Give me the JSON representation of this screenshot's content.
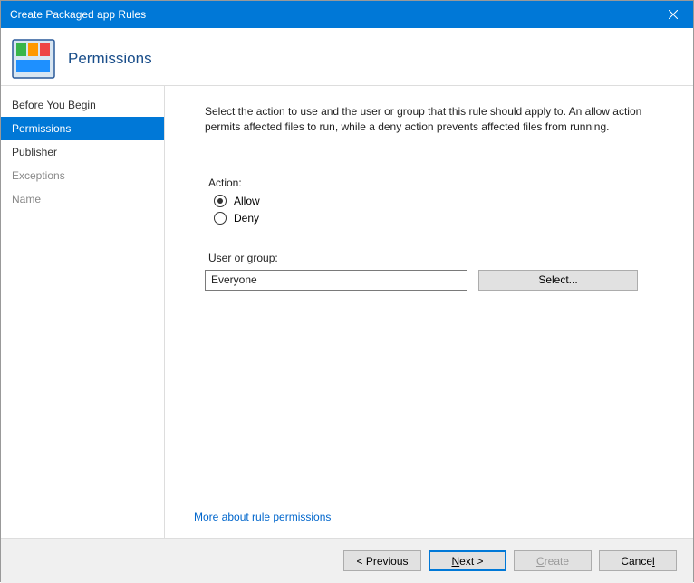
{
  "window": {
    "title": "Create Packaged app Rules"
  },
  "header": {
    "title": "Permissions"
  },
  "sidebar": {
    "items": [
      {
        "label": "Before You Begin",
        "selected": false,
        "disabled": false
      },
      {
        "label": "Permissions",
        "selected": true,
        "disabled": false
      },
      {
        "label": "Publisher",
        "selected": false,
        "disabled": false
      },
      {
        "label": "Exceptions",
        "selected": false,
        "disabled": true
      },
      {
        "label": "Name",
        "selected": false,
        "disabled": true
      }
    ]
  },
  "main": {
    "description": "Select the action to use and the user or group that this rule should apply to. An allow action permits affected files to run, while a deny action prevents affected files from running.",
    "action_label": "Action:",
    "radios": {
      "allow": "Allow",
      "deny": "Deny",
      "selected": "allow"
    },
    "user_group_label": "User or group:",
    "user_group_value": "Everyone",
    "select_button": "Select...",
    "more_link": "More about rule permissions"
  },
  "footer": {
    "previous": "< Previous",
    "next_prefix": "N",
    "next_rest": "ext >",
    "create_prefix": "C",
    "create_rest": "reate",
    "cancel_prefix": "Cance",
    "cancel_underlined": "l"
  }
}
